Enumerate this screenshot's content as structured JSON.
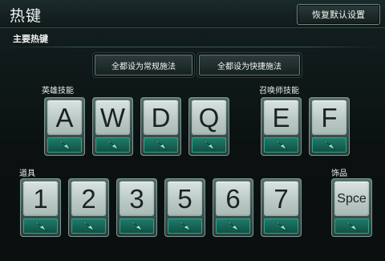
{
  "header": {
    "title": "热键",
    "reset_button": "恢复默认设置"
  },
  "main": {
    "section_title": "主要热键",
    "mode_buttons": [
      "全都设为常规施法",
      "全都设为快捷施法"
    ],
    "groups": {
      "hero_skills": {
        "label": "英雄技能",
        "keys": [
          "A",
          "W",
          "D",
          "Q"
        ]
      },
      "summoner_skills": {
        "label": "召唤师技能",
        "keys": [
          "E",
          "F"
        ]
      },
      "items": {
        "label": "道具",
        "keys": [
          "1",
          "2",
          "3",
          "5",
          "6",
          "7"
        ]
      },
      "trinket": {
        "label": "饰品",
        "keys": [
          "Spce"
        ]
      }
    }
  },
  "colors": {
    "background": "#0d1414",
    "accent_green": "#1f7e6b",
    "key_face": "#d9e3e1"
  },
  "icons": {
    "key_arrow": "arrow-down-right-icon"
  }
}
